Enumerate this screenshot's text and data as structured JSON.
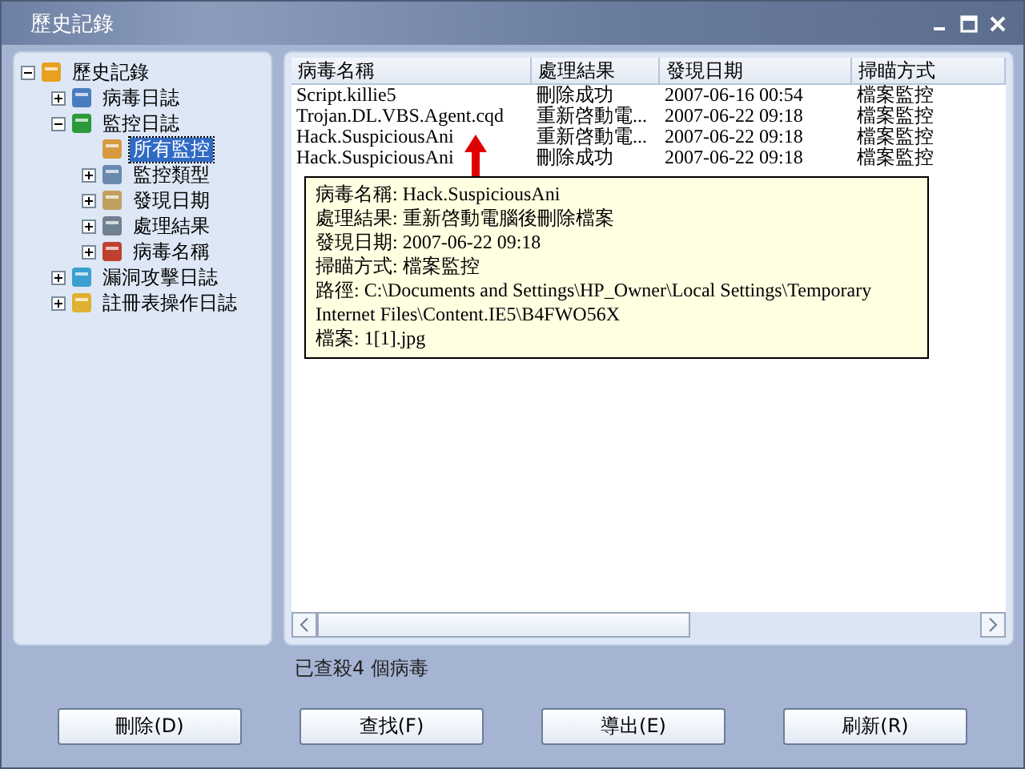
{
  "window": {
    "title": "歷史記錄"
  },
  "tree": [
    {
      "label": "歷史記錄",
      "kind": "folder",
      "expanded": true,
      "selected": false,
      "children": [
        {
          "label": "病毒日誌",
          "kind": "folder",
          "expanded": false,
          "selected": false
        },
        {
          "label": "監控日誌",
          "kind": "folder",
          "expanded": true,
          "selected": false,
          "children": [
            {
              "label": "所有監控",
              "kind": "leaf",
              "selected": true
            },
            {
              "label": "監控類型",
              "kind": "folder",
              "expanded": false,
              "selected": false
            },
            {
              "label": "發現日期",
              "kind": "folder",
              "expanded": false,
              "selected": false
            },
            {
              "label": "處理結果",
              "kind": "folder",
              "expanded": false,
              "selected": false
            },
            {
              "label": "病毒名稱",
              "kind": "folder",
              "expanded": false,
              "selected": false
            }
          ]
        },
        {
          "label": "漏洞攻擊日誌",
          "kind": "folder",
          "expanded": false,
          "selected": false
        },
        {
          "label": "註冊表操作日誌",
          "kind": "folder",
          "expanded": false,
          "selected": false
        }
      ]
    }
  ],
  "table": {
    "columns": [
      "病毒名稱",
      "處理結果",
      "發現日期",
      "掃瞄方式"
    ],
    "rows": [
      [
        "Script.killie5",
        "刪除成功",
        "2007-06-16 00:54",
        "檔案監控"
      ],
      [
        "Trojan.DL.VBS.Agent.cqd",
        "重新啓動電...",
        "2007-06-22 09:18",
        "檔案監控"
      ],
      [
        "Hack.SuspiciousAni",
        "重新啓動電...",
        "2007-06-22 09:18",
        "檔案監控"
      ],
      [
        "Hack.SuspiciousAni",
        "刪除成功",
        "2007-06-22 09:18",
        "檔案監控"
      ]
    ]
  },
  "tooltip": {
    "lines": [
      "病毒名稱: Hack.SuspiciousAni",
      "處理結果: 重新啓動電腦後刪除檔案",
      "發現日期: 2007-06-22 09:18",
      "掃瞄方式: 檔案監控",
      "路徑: C:\\Documents and Settings\\HP_Owner\\Local Settings\\Temporary Internet Files\\Content.IE5\\B4FWO56X",
      "檔案: 1[1].jpg"
    ]
  },
  "status": "已查殺4 個病毒",
  "buttons": [
    "刪除(D)",
    "查找(F)",
    "導出(E)",
    "刷新(R)"
  ]
}
